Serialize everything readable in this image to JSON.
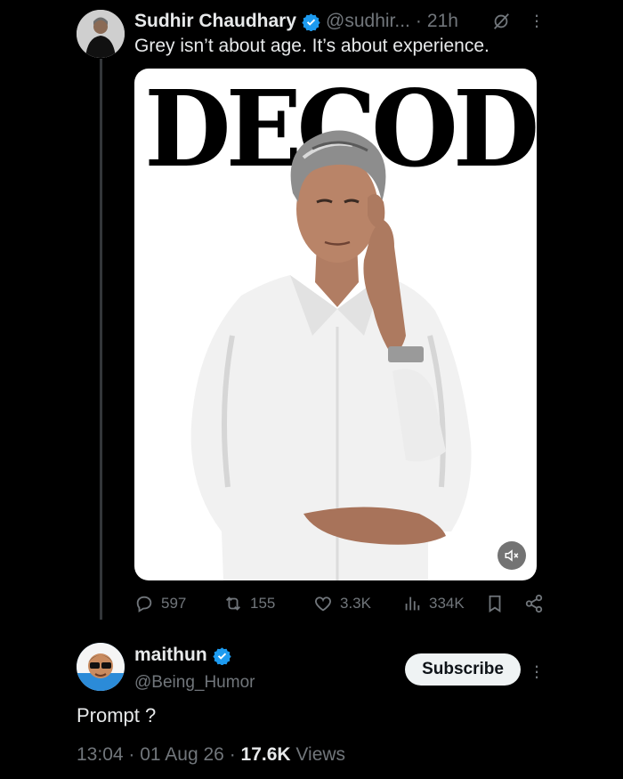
{
  "colors": {
    "background": "#000000",
    "text": "#e7e9ea",
    "muted": "#71767b",
    "verified": "#1d9bf0"
  },
  "tweet": {
    "author_name": "Sudhir Chaudhary",
    "author_handle": "@sudhir...",
    "time_sep": "·",
    "time": "21h",
    "text": "Grey isn’t about age. It’s about experience.",
    "media_title": "DECODE",
    "icons": [
      "verified-badge-icon",
      "grok-icon",
      "more-icon",
      "mute-icon"
    ]
  },
  "actions": {
    "replies": "597",
    "reposts": "155",
    "likes": "3.3K",
    "views": "334K",
    "icons": [
      "reply-icon",
      "repost-icon",
      "like-icon",
      "views-icon",
      "bookmark-icon",
      "share-icon"
    ]
  },
  "reply": {
    "author_name": "maithun",
    "author_handle": "@Being_Humor",
    "subscribe_label": "Subscribe",
    "text": "Prompt ?",
    "time": "13:04",
    "sep1": "·",
    "date": "01 Aug 26",
    "sep2": "·",
    "views_count": "17.6K",
    "views_label": "Views"
  }
}
